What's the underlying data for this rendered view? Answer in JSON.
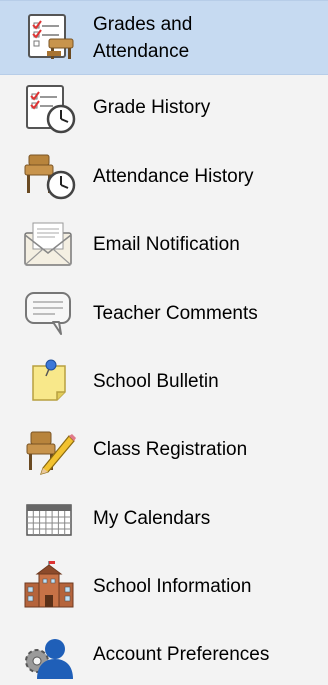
{
  "menu": {
    "items": [
      {
        "label": "Grades and Attendance",
        "icon": "grades-attendance-icon",
        "active": true
      },
      {
        "label": "Grade History",
        "icon": "grade-history-icon"
      },
      {
        "label": "Attendance History",
        "icon": "attendance-history-icon"
      },
      {
        "label": "Email Notification",
        "icon": "email-notification-icon"
      },
      {
        "label": "Teacher Comments",
        "icon": "teacher-comments-icon"
      },
      {
        "label": "School Bulletin",
        "icon": "school-bulletin-icon"
      },
      {
        "label": "Class Registration",
        "icon": "class-registration-icon"
      },
      {
        "label": "My Calendars",
        "icon": "my-calendars-icon"
      },
      {
        "label": "School Information",
        "icon": "school-information-icon"
      },
      {
        "label": "Account Preferences",
        "icon": "account-preferences-icon"
      }
    ]
  },
  "colors": {
    "page_background": "#f3f3f3",
    "active_background": "#c6daf1"
  }
}
